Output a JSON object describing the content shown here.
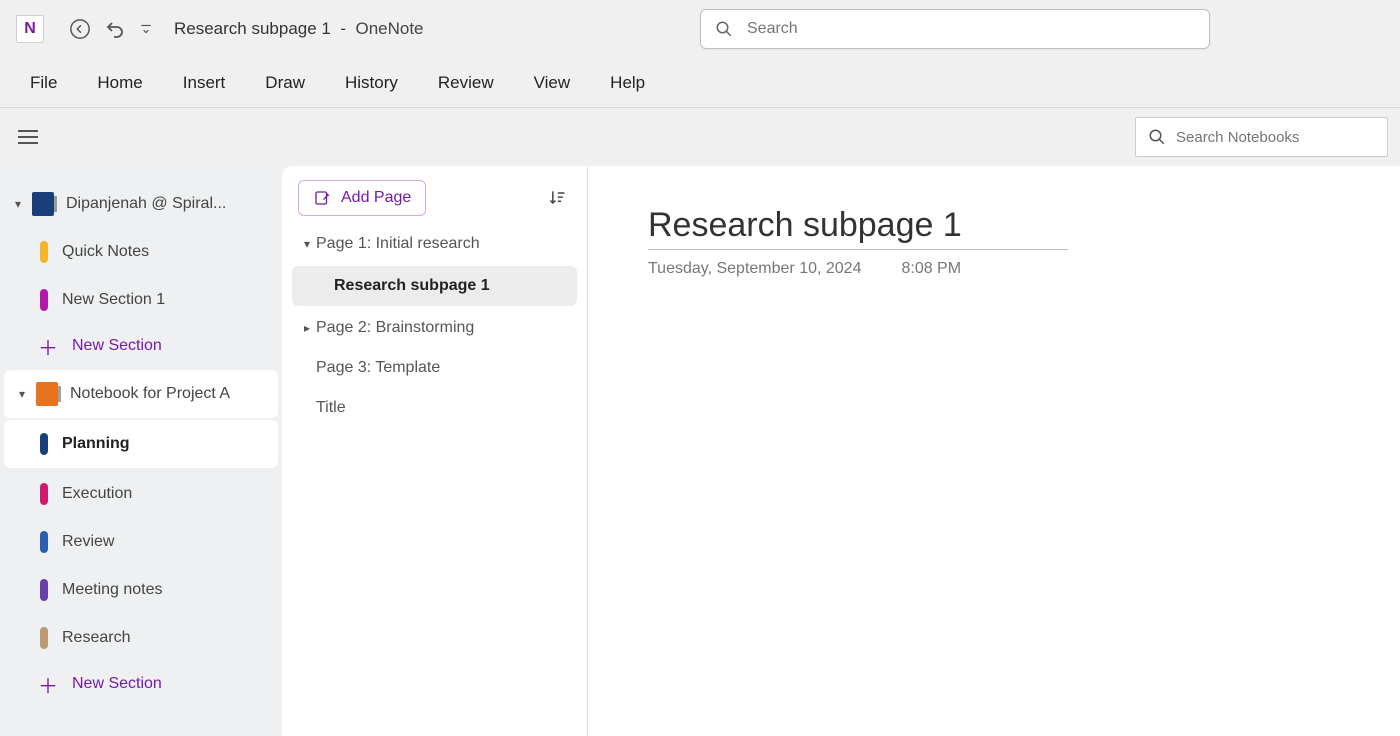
{
  "titlebar": {
    "doc_title": "Research subpage 1",
    "separator": "-",
    "app_name": "OneNote",
    "search_placeholder": "Search"
  },
  "menu": [
    "File",
    "Home",
    "Insert",
    "Draw",
    "History",
    "Review",
    "View",
    "Help"
  ],
  "notebook_search_placeholder": "Search Notebooks",
  "sidebar": {
    "notebooks": [
      {
        "name": "Dipanjenah @ Spiral...",
        "color": "navy",
        "expanded": true,
        "sections": [
          {
            "name": "Quick Notes",
            "color": "#f3b52a"
          },
          {
            "name": "New Section 1",
            "color": "#b01aa7"
          }
        ]
      },
      {
        "name": "Notebook for Project A",
        "color": "orange",
        "expanded": true,
        "selected": true,
        "sections": [
          {
            "name": "Planning",
            "color": "#1a3e7a",
            "active": true
          },
          {
            "name": "Execution",
            "color": "#d21a6a"
          },
          {
            "name": "Review",
            "color": "#2a5fb0"
          },
          {
            "name": "Meeting notes",
            "color": "#6a3fa7"
          },
          {
            "name": "Research",
            "color": "#b99a72"
          }
        ]
      }
    ],
    "new_section_label": "New Section"
  },
  "pagelist": {
    "add_page_label": "Add Page",
    "pages": [
      {
        "label": "Page 1: Initial research",
        "expanded": true
      },
      {
        "label": "Research subpage 1",
        "sub": true,
        "selected": true
      },
      {
        "label": "Page 2: Brainstorming",
        "collapsed": true
      },
      {
        "label": "Page 3: Template",
        "noarrow": true
      },
      {
        "label": "Title",
        "noarrow": true
      }
    ]
  },
  "content": {
    "title": "Research subpage 1",
    "date": "Tuesday, September 10, 2024",
    "time": "8:08 PM"
  }
}
